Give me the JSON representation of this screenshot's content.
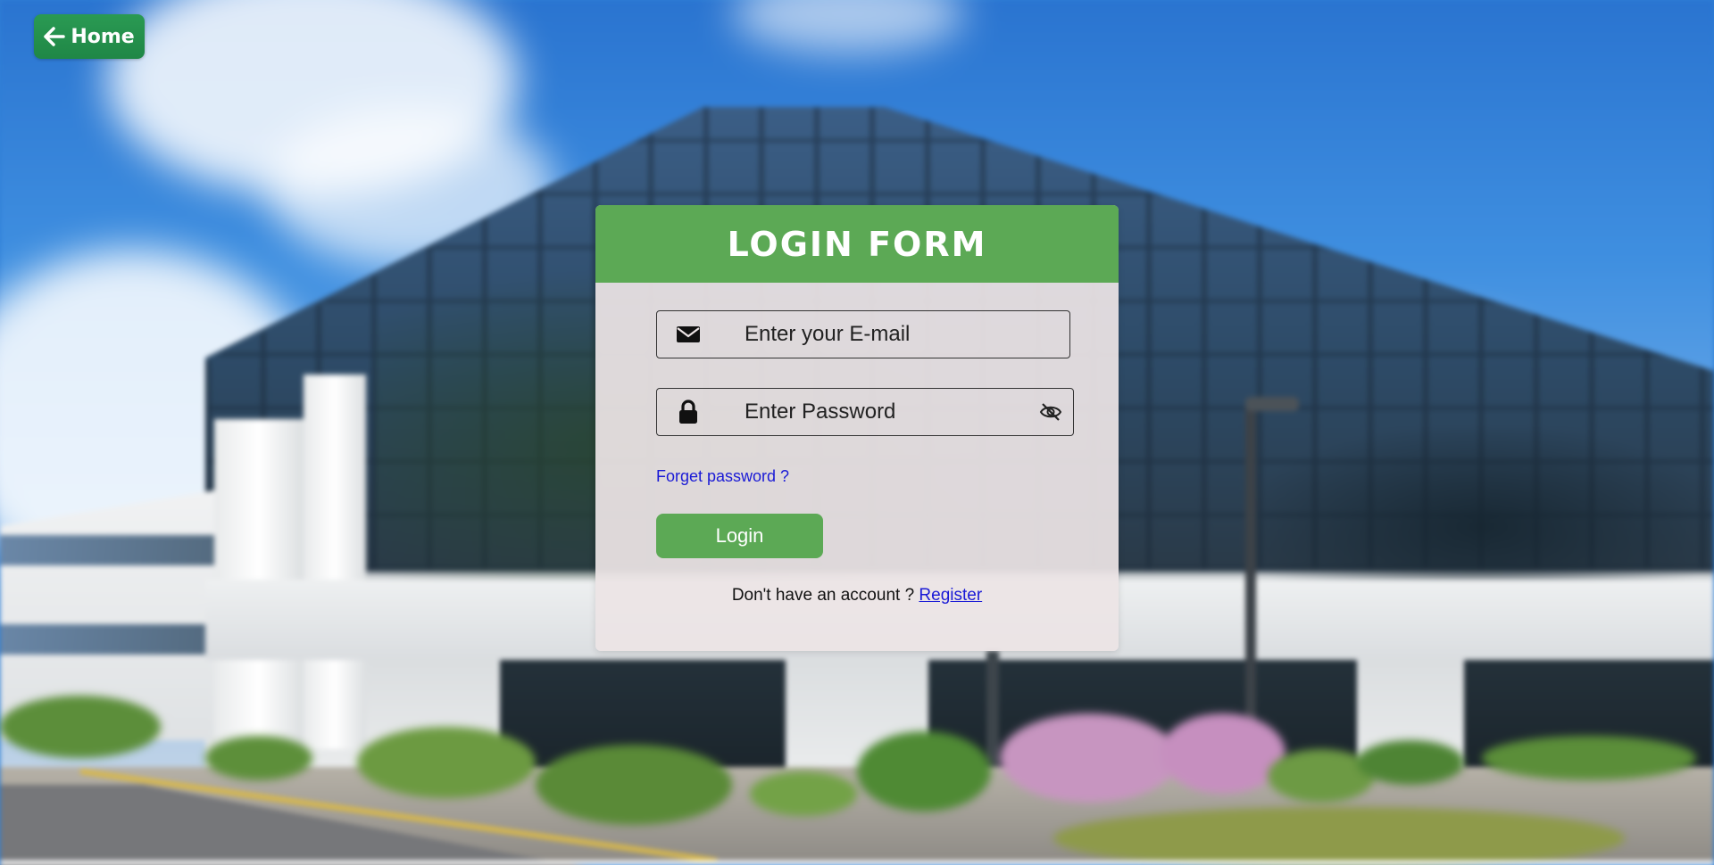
{
  "nav": {
    "home_label": "Home",
    "home_icon": "arrow-left-icon"
  },
  "login_form": {
    "title": "LOGIN FORM",
    "email": {
      "placeholder": "Enter your E-mail",
      "value": "",
      "icon": "envelope-icon"
    },
    "password": {
      "placeholder": "Enter Password",
      "value": "",
      "icon": "lock-icon",
      "toggle_icon": "eye-slash-icon"
    },
    "forgot_label": "Forget password ?",
    "login_label": "Login",
    "signup_prompt": "Don't have an account ?",
    "register_label": "Register"
  },
  "colors": {
    "header_green": "#5ca955",
    "home_green": "#1f8746",
    "link_blue": "#1a1ad6",
    "card_bg": "#ece4e5"
  }
}
